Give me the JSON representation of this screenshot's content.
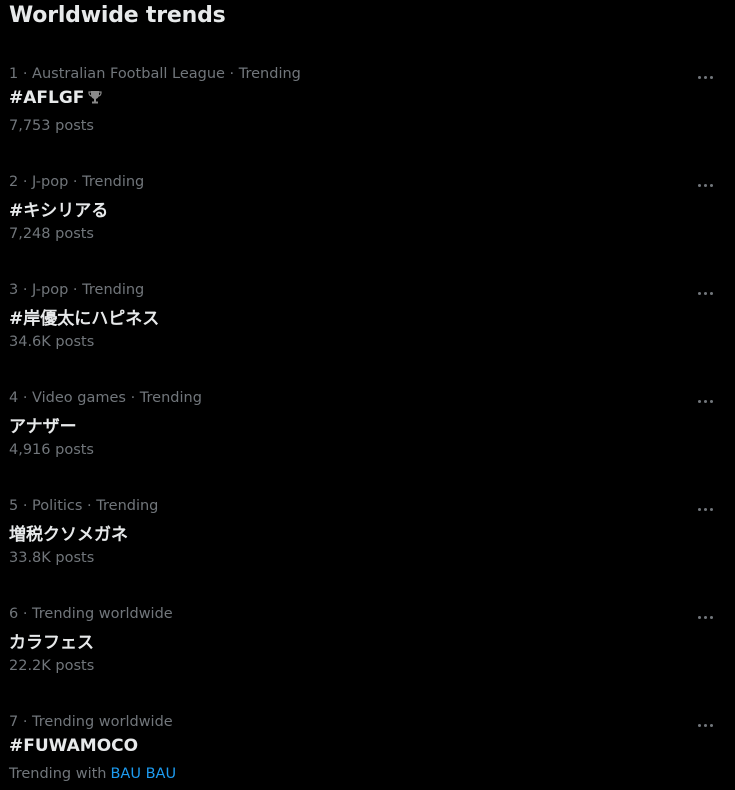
{
  "header": {
    "title": "Worldwide trends"
  },
  "trends": [
    {
      "meta": "1 · Australian Football League · Trending",
      "name": "#AFLGF",
      "posts": "7,753 posts",
      "icon": "trophy-icon"
    },
    {
      "meta": "2 · J-pop · Trending",
      "name": "#キシリアる",
      "posts": "7,248 posts"
    },
    {
      "meta": "3 · J-pop · Trending",
      "name": "#岸優太にハピネス",
      "posts": "34.6K posts"
    },
    {
      "meta": "4 · Video games · Trending",
      "name": "アナザー",
      "posts": "4,916 posts"
    },
    {
      "meta": "5 · Politics · Trending",
      "name": "増税クソメガネ",
      "posts": "33.8K posts"
    },
    {
      "meta": "6 · Trending worldwide",
      "name": "カラフェス",
      "posts": "22.2K posts"
    },
    {
      "meta": "7 · Trending worldwide",
      "name": "#FUWAMOCO",
      "posts_prefix": "Trending with",
      "posts_link": "BAU BAU"
    }
  ],
  "colors": {
    "background": "#000000",
    "primary_text": "#e7e9ea",
    "secondary_text": "#71767b",
    "link": "#1d9bf0"
  }
}
